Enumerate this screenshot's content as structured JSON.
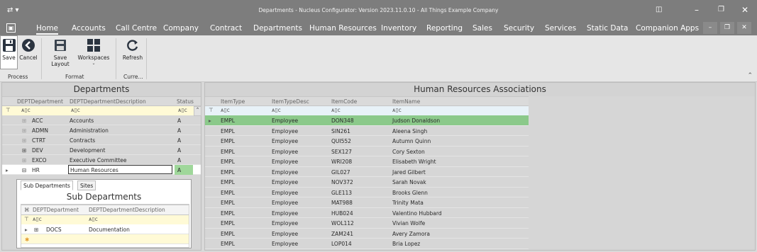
{
  "window": {
    "title": "Departments - Nucleus Configurator: Version 2023.11.0.10 - All Things Example Company"
  },
  "menu": {
    "items": [
      "Home",
      "Accounts",
      "Call Centre",
      "Company",
      "Contract",
      "Departments",
      "Human Resources",
      "Inventory",
      "Reporting",
      "Sales",
      "Security",
      "Services",
      "Static Data",
      "Companion Apps"
    ],
    "active": "Home"
  },
  "ribbon": {
    "buttons": {
      "save": "Save",
      "cancel": "Cancel",
      "save_layout": "Save Layout",
      "workspaces": "Workspaces",
      "refresh": "Refresh"
    },
    "groups": {
      "process": "Process",
      "format": "Format",
      "current": "Curre..."
    }
  },
  "departments_pane": {
    "title": "Departments",
    "columns": [
      "DEPTDepartment",
      "DEPTDepartmentDescription",
      "Status"
    ],
    "rows": [
      {
        "code": "ACC",
        "desc": "Accounts",
        "status": "A"
      },
      {
        "code": "ADMN",
        "desc": "Administration",
        "status": "A"
      },
      {
        "code": "CTRT",
        "desc": "Contracts",
        "status": "A"
      },
      {
        "code": "DEV",
        "desc": "Development",
        "status": "A"
      },
      {
        "code": "EXCO",
        "desc": "Executive Committee",
        "status": "A"
      },
      {
        "code": "HR",
        "desc": "Human Resources",
        "status": "A"
      }
    ],
    "selected_index": 5
  },
  "sub_departments": {
    "tabs": [
      "Sub Departments",
      "Sites"
    ],
    "title": "Sub Departments",
    "columns": [
      "DEPTDepartment",
      "DEPTDepartmentDescription"
    ],
    "rows": [
      {
        "code": "DOCS",
        "desc": "Documentation"
      }
    ]
  },
  "hr_associations": {
    "title": "Human Resources Associations",
    "columns": [
      "ItemType",
      "ItemTypeDesc",
      "ItemCode",
      "ItemName"
    ],
    "rows": [
      {
        "type": "EMPL",
        "desc": "Employee",
        "code": "DON348",
        "name": "Judson Donaldson"
      },
      {
        "type": "EMPL",
        "desc": "Employee",
        "code": "SIN261",
        "name": "Aleena Singh"
      },
      {
        "type": "EMPL",
        "desc": "Employee",
        "code": "QUI552",
        "name": "Autumn Quinn"
      },
      {
        "type": "EMPL",
        "desc": "Employee",
        "code": "SEX127",
        "name": "Cory Sexton"
      },
      {
        "type": "EMPL",
        "desc": "Employee",
        "code": "WRI208",
        "name": "Elisabeth Wright"
      },
      {
        "type": "EMPL",
        "desc": "Employee",
        "code": "GIL027",
        "name": "Jared Gilbert"
      },
      {
        "type": "EMPL",
        "desc": "Employee",
        "code": "NOV372",
        "name": "Sarah Novak"
      },
      {
        "type": "EMPL",
        "desc": "Employee",
        "code": "GLE113",
        "name": "Brooks Glenn"
      },
      {
        "type": "EMPL",
        "desc": "Employee",
        "code": "MAT988",
        "name": "Trinity Mata"
      },
      {
        "type": "EMPL",
        "desc": "Employee",
        "code": "HUB024",
        "name": "Valentino Hubbard"
      },
      {
        "type": "EMPL",
        "desc": "Employee",
        "code": "WOL112",
        "name": "Vivian Wolfe"
      },
      {
        "type": "EMPL",
        "desc": "Employee",
        "code": "ZAM241",
        "name": "Avery Zamora"
      },
      {
        "type": "EMPL",
        "desc": "Employee",
        "code": "LOP014",
        "name": "Bria Lopez"
      }
    ],
    "selected_index": 0
  },
  "colors": {
    "titlebar": "#7d7d7d",
    "filter_row": "#fffad6",
    "selected_row": "#9fd79a",
    "hr_selected_row": "#8bc98a"
  }
}
